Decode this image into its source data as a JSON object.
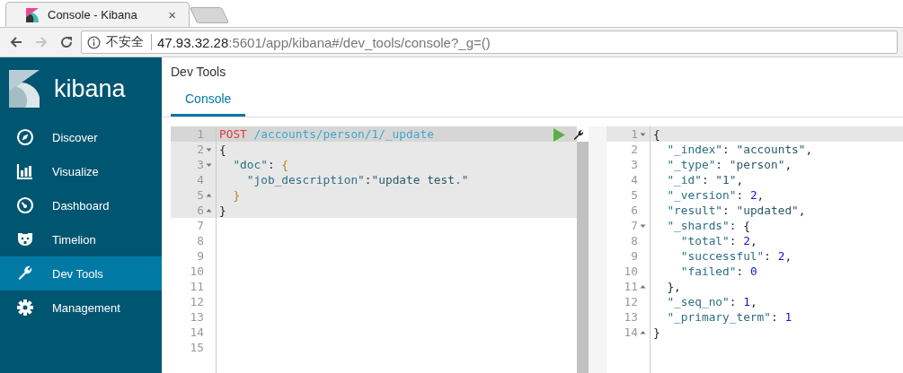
{
  "browser": {
    "tab_title": "Console - Kibana",
    "tab_close": "×",
    "security_label": "不安全",
    "url_host": "47.93.32.28",
    "url_rest": ":5601/app/kibana#/dev_tools/console?_g=()",
    "forward_disabled": true
  },
  "sidebar": {
    "logo_text": "kibana",
    "items": [
      {
        "label": "Discover",
        "selected": false
      },
      {
        "label": "Visualize",
        "selected": false
      },
      {
        "label": "Dashboard",
        "selected": false
      },
      {
        "label": "Timelion",
        "selected": false
      },
      {
        "label": "Dev Tools",
        "selected": true
      },
      {
        "label": "Management",
        "selected": false
      }
    ]
  },
  "page_title": "Dev Tools",
  "tabs": [
    {
      "label": "Console",
      "selected": true
    }
  ],
  "request": {
    "lines": [
      {
        "number": "1",
        "fold_start": false,
        "fold_end": false,
        "selected": true,
        "active_line": true,
        "tokens": [
          {
            "kind": "method",
            "text": "POST"
          },
          {
            "kind": "url",
            "text": " /accounts/person/1/_update"
          }
        ]
      },
      {
        "number": "2",
        "fold_start": true,
        "fold_end": false,
        "selected": true,
        "active_line": false,
        "tokens": [
          {
            "kind": "punct",
            "text": "{"
          }
        ]
      },
      {
        "number": "3",
        "fold_start": true,
        "fold_end": false,
        "selected": true,
        "active_line": false,
        "tokens": [
          {
            "kind": "key",
            "text": "  \"doc\""
          },
          {
            "kind": "punct",
            "text": ": "
          },
          {
            "kind": "brace",
            "text": "{"
          }
        ]
      },
      {
        "number": "4",
        "fold_start": false,
        "fold_end": false,
        "selected": true,
        "active_line": false,
        "tokens": [
          {
            "kind": "key",
            "text": "    \"job_description\""
          },
          {
            "kind": "punct",
            "text": ":"
          },
          {
            "kind": "string",
            "text": "\"update test.\""
          }
        ]
      },
      {
        "number": "5",
        "fold_start": false,
        "fold_end": true,
        "selected": true,
        "active_line": false,
        "tokens": [
          {
            "kind": "brace",
            "text": "  }"
          }
        ]
      },
      {
        "number": "6",
        "fold_start": false,
        "fold_end": true,
        "selected": true,
        "active_line": false,
        "tokens": [
          {
            "kind": "punct",
            "text": "}"
          }
        ]
      },
      {
        "number": "7",
        "fold_start": false,
        "fold_end": false,
        "selected": false,
        "active_line": false
      },
      {
        "number": "8",
        "fold_start": false,
        "fold_end": false,
        "selected": false,
        "active_line": false
      },
      {
        "number": "9",
        "fold_start": false,
        "fold_end": false,
        "selected": false,
        "active_line": false
      },
      {
        "number": "10",
        "fold_start": false,
        "fold_end": false,
        "selected": false,
        "active_line": false
      },
      {
        "number": "11",
        "fold_start": false,
        "fold_end": false,
        "selected": false,
        "active_line": false
      },
      {
        "number": "12",
        "fold_start": false,
        "fold_end": false,
        "selected": false,
        "active_line": false
      },
      {
        "number": "13",
        "fold_start": false,
        "fold_end": false,
        "selected": false,
        "active_line": false
      },
      {
        "number": "14",
        "fold_start": false,
        "fold_end": false,
        "selected": false,
        "active_line": false
      },
      {
        "number": "15",
        "fold_start": false,
        "fold_end": false,
        "selected": false,
        "active_line": false
      }
    ]
  },
  "response": {
    "lines": [
      {
        "number": "1",
        "fold_start": true,
        "fold_end": false,
        "active_line": true,
        "tokens": [
          {
            "kind": "punct",
            "text": "{"
          }
        ]
      },
      {
        "number": "2",
        "fold_start": false,
        "fold_end": false,
        "active_line": false,
        "tokens": [
          {
            "kind": "key",
            "text": "  \"_index\""
          },
          {
            "kind": "punct",
            "text": ": "
          },
          {
            "kind": "string",
            "text": "\"accounts\""
          },
          {
            "kind": "punct",
            "text": ","
          }
        ]
      },
      {
        "number": "3",
        "fold_start": false,
        "fold_end": false,
        "active_line": false,
        "tokens": [
          {
            "kind": "key",
            "text": "  \"_type\""
          },
          {
            "kind": "punct",
            "text": ": "
          },
          {
            "kind": "string",
            "text": "\"person\""
          },
          {
            "kind": "punct",
            "text": ","
          }
        ]
      },
      {
        "number": "4",
        "fold_start": false,
        "fold_end": false,
        "active_line": false,
        "tokens": [
          {
            "kind": "key",
            "text": "  \"_id\""
          },
          {
            "kind": "punct",
            "text": ": "
          },
          {
            "kind": "string",
            "text": "\"1\""
          },
          {
            "kind": "punct",
            "text": ","
          }
        ]
      },
      {
        "number": "5",
        "fold_start": false,
        "fold_end": false,
        "active_line": false,
        "tokens": [
          {
            "kind": "key",
            "text": "  \"_version\""
          },
          {
            "kind": "punct",
            "text": ": "
          },
          {
            "kind": "number",
            "text": "2"
          },
          {
            "kind": "punct",
            "text": ","
          }
        ]
      },
      {
        "number": "6",
        "fold_start": false,
        "fold_end": false,
        "active_line": false,
        "tokens": [
          {
            "kind": "key",
            "text": "  \"result\""
          },
          {
            "kind": "punct",
            "text": ": "
          },
          {
            "kind": "string",
            "text": "\"updated\""
          },
          {
            "kind": "punct",
            "text": ","
          }
        ]
      },
      {
        "number": "7",
        "fold_start": true,
        "fold_end": false,
        "active_line": false,
        "tokens": [
          {
            "kind": "key",
            "text": "  \"_shards\""
          },
          {
            "kind": "punct",
            "text": ": {"
          }
        ]
      },
      {
        "number": "8",
        "fold_start": false,
        "fold_end": false,
        "active_line": false,
        "tokens": [
          {
            "kind": "key",
            "text": "    \"total\""
          },
          {
            "kind": "punct",
            "text": ": "
          },
          {
            "kind": "number",
            "text": "2"
          },
          {
            "kind": "punct",
            "text": ","
          }
        ]
      },
      {
        "number": "9",
        "fold_start": false,
        "fold_end": false,
        "active_line": false,
        "tokens": [
          {
            "kind": "key",
            "text": "    \"successful\""
          },
          {
            "kind": "punct",
            "text": ": "
          },
          {
            "kind": "number",
            "text": "2"
          },
          {
            "kind": "punct",
            "text": ","
          }
        ]
      },
      {
        "number": "10",
        "fold_start": false,
        "fold_end": false,
        "active_line": false,
        "tokens": [
          {
            "kind": "key",
            "text": "    \"failed\""
          },
          {
            "kind": "punct",
            "text": ": "
          },
          {
            "kind": "number",
            "text": "0"
          }
        ]
      },
      {
        "number": "11",
        "fold_start": false,
        "fold_end": true,
        "active_line": false,
        "tokens": [
          {
            "kind": "punct",
            "text": "  },"
          }
        ]
      },
      {
        "number": "12",
        "fold_start": false,
        "fold_end": false,
        "active_line": false,
        "tokens": [
          {
            "kind": "key",
            "text": "  \"_seq_no\""
          },
          {
            "kind": "punct",
            "text": ": "
          },
          {
            "kind": "number",
            "text": "1"
          },
          {
            "kind": "punct",
            "text": ","
          }
        ]
      },
      {
        "number": "13",
        "fold_start": false,
        "fold_end": false,
        "active_line": false,
        "tokens": [
          {
            "kind": "key",
            "text": "  \"_primary_term\""
          },
          {
            "kind": "punct",
            "text": ": "
          },
          {
            "kind": "number",
            "text": "1"
          }
        ]
      },
      {
        "number": "14",
        "fold_start": false,
        "fold_end": true,
        "active_line": false,
        "tokens": [
          {
            "kind": "punct",
            "text": "}"
          }
        ]
      }
    ]
  }
}
